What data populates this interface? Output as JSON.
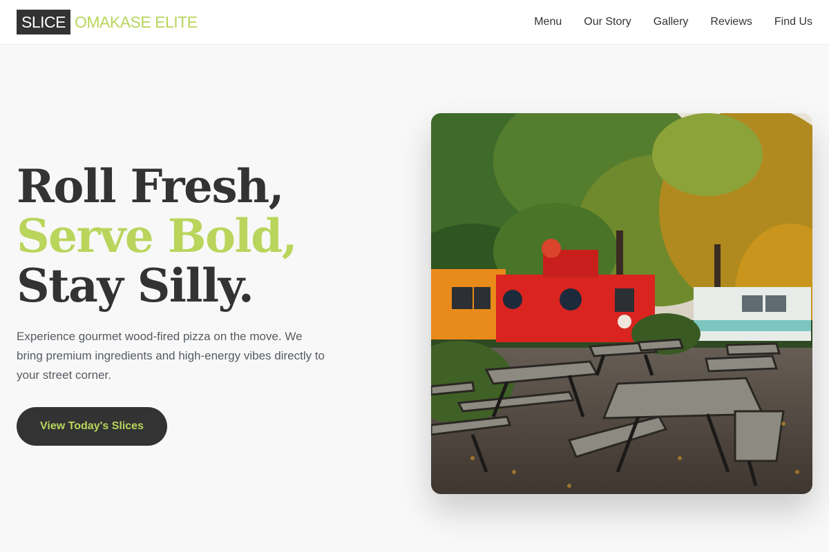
{
  "brand": {
    "box": "SLICE",
    "name": "OMAKASE ELITE"
  },
  "nav": {
    "items": [
      "Menu",
      "Our Story",
      "Gallery",
      "Reviews",
      "Find Us"
    ]
  },
  "hero": {
    "line1": "Roll Fresh,",
    "line2": "Serve Bold,",
    "line3": "Stay Silly.",
    "description": "Experience gourmet wood-fired pizza on the move. We bring premium ingredients and high-energy vibes directly to your street corner.",
    "cta_label": "View Today's Slices"
  },
  "colors": {
    "accent": "#b9d55b",
    "dark": "#333333",
    "background": "#f8f8f8"
  }
}
